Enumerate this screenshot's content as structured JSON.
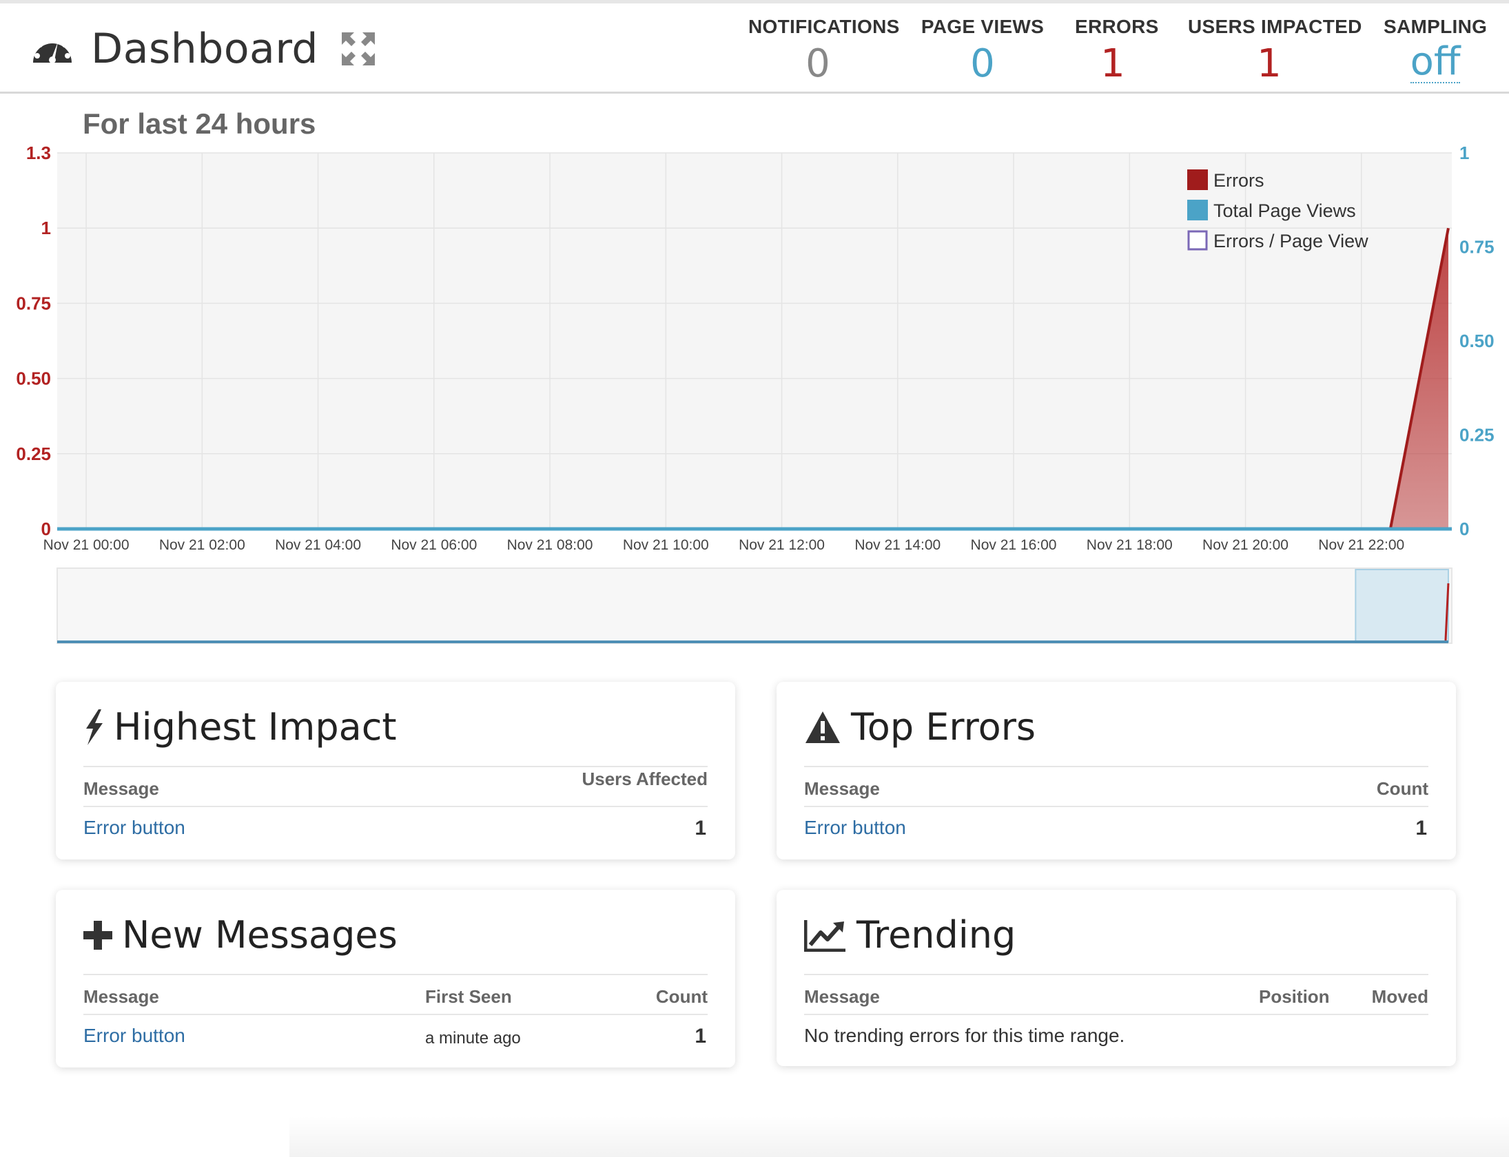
{
  "header": {
    "title": "Dashboard",
    "stats": [
      {
        "label": "NOTIFICATIONS",
        "value": "0",
        "color": "#888888"
      },
      {
        "label": "PAGE VIEWS",
        "value": "0",
        "color": "#4ba3c7"
      },
      {
        "label": "ERRORS",
        "value": "1",
        "color": "#b22222"
      },
      {
        "label": "USERS IMPACTED",
        "value": "1",
        "color": "#b22222"
      },
      {
        "label": "SAMPLING",
        "value": "off",
        "color": "#4ba3c7"
      }
    ]
  },
  "range_title": "For last 24 hours",
  "chart_data": {
    "type": "area",
    "x_labels": [
      "Nov 21 00:00",
      "Nov 21 02:00",
      "Nov 21 04:00",
      "Nov 21 06:00",
      "Nov 21 08:00",
      "Nov 21 10:00",
      "Nov 21 12:00",
      "Nov 21 14:00",
      "Nov 21 16:00",
      "Nov 21 18:00",
      "Nov 21 20:00",
      "Nov 21 22:00"
    ],
    "x_range_hours": [
      -0.5,
      23.56
    ],
    "y_left": {
      "ticks": [
        "0",
        "0.25",
        "0.50",
        "0.75",
        "1",
        "1.3"
      ],
      "values": [
        0,
        0.25,
        0.5,
        0.75,
        1,
        1.25
      ],
      "range": [
        0,
        1.25
      ],
      "color": "#b22222"
    },
    "y_right": {
      "ticks": [
        "0",
        "0.25",
        "0.50",
        "0.75",
        "1"
      ],
      "values": [
        0,
        0.25,
        0.5,
        0.75,
        1
      ],
      "range": [
        0,
        1
      ],
      "color": "#4ba3c7"
    },
    "grid": true,
    "legend_position": "top-right",
    "series": [
      {
        "name": "Errors",
        "color": "#a01c1c",
        "style": "area",
        "points": [
          [
            22.5,
            0
          ],
          [
            23.5,
            1
          ]
        ]
      },
      {
        "name": "Total Page Views",
        "color": "#4ba3c7",
        "style": "line",
        "points": [
          [
            -0.5,
            0
          ],
          [
            23.5,
            0
          ]
        ]
      },
      {
        "name": "Errors / Page View",
        "color": "#7b68b6",
        "style": "line",
        "points": []
      }
    ],
    "navigator": {
      "selected_range_hours": [
        21.9,
        23.5
      ]
    }
  },
  "cards": {
    "highest_impact": {
      "title": "Highest Impact",
      "columns": [
        "Message",
        "Users Affected"
      ],
      "rows": [
        {
          "message": "Error button",
          "value": "1"
        }
      ]
    },
    "top_errors": {
      "title": "Top Errors",
      "columns": [
        "Message",
        "Count"
      ],
      "rows": [
        {
          "message": "Error button",
          "value": "1"
        }
      ]
    },
    "new_messages": {
      "title": "New Messages",
      "columns": [
        "Message",
        "First Seen",
        "Count"
      ],
      "rows": [
        {
          "message": "Error button",
          "first_seen": "a minute ago",
          "value": "1"
        }
      ]
    },
    "trending": {
      "title": "Trending",
      "columns": [
        "Message",
        "Position",
        "Moved"
      ],
      "empty_text": "No trending errors for this time range."
    }
  }
}
